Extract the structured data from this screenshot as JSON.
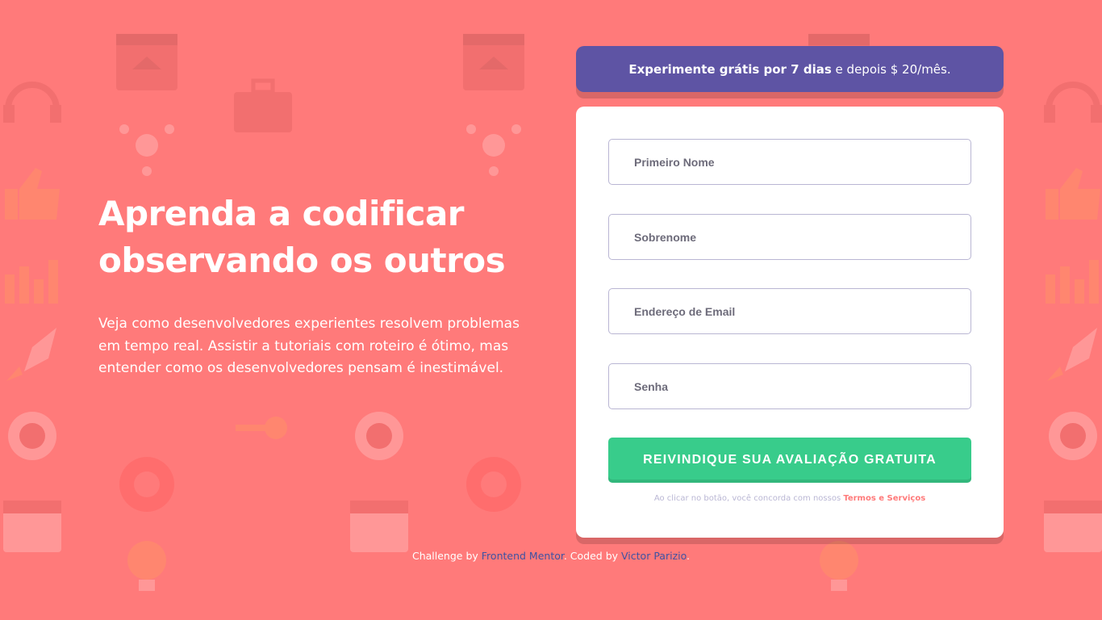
{
  "theme": {
    "background": "#ff7a7a",
    "promo_background": "#5e54a4",
    "cta_background": "#38cc8b",
    "accent_link": "#ff7a7a",
    "attribution_link": "#3e52a3"
  },
  "hero": {
    "title_line1": "Aprenda a codificar",
    "title_line2": "observando os outros",
    "description": "Veja como desenvolvedores experientes resolvem problemas em tempo real. Assistir a tutoriais com roteiro é ótimo, mas entender como os desenvolvedores pensam é inestimável."
  },
  "promo": {
    "bold": "Experimente grátis por 7 dias",
    "rest": "e depois $ 20/mês."
  },
  "form": {
    "fields": [
      {
        "placeholder": "Primeiro Nome",
        "value": ""
      },
      {
        "placeholder": "Sobrenome",
        "value": ""
      },
      {
        "placeholder": "Endereço de Email",
        "value": ""
      },
      {
        "placeholder": "Senha",
        "value": ""
      }
    ],
    "submit_label": "REIVINDIQUE SUA AVALIAÇÃO GRATUITA",
    "terms_text": "Ao clicar no botão, você concorda com nossos",
    "terms_link": "Termos e Serviços"
  },
  "attribution": {
    "prefix": "Challenge by",
    "link1": "Frontend Mentor",
    "middle": ". Coded by",
    "link2": "Victor Parizio",
    "suffix": "."
  }
}
